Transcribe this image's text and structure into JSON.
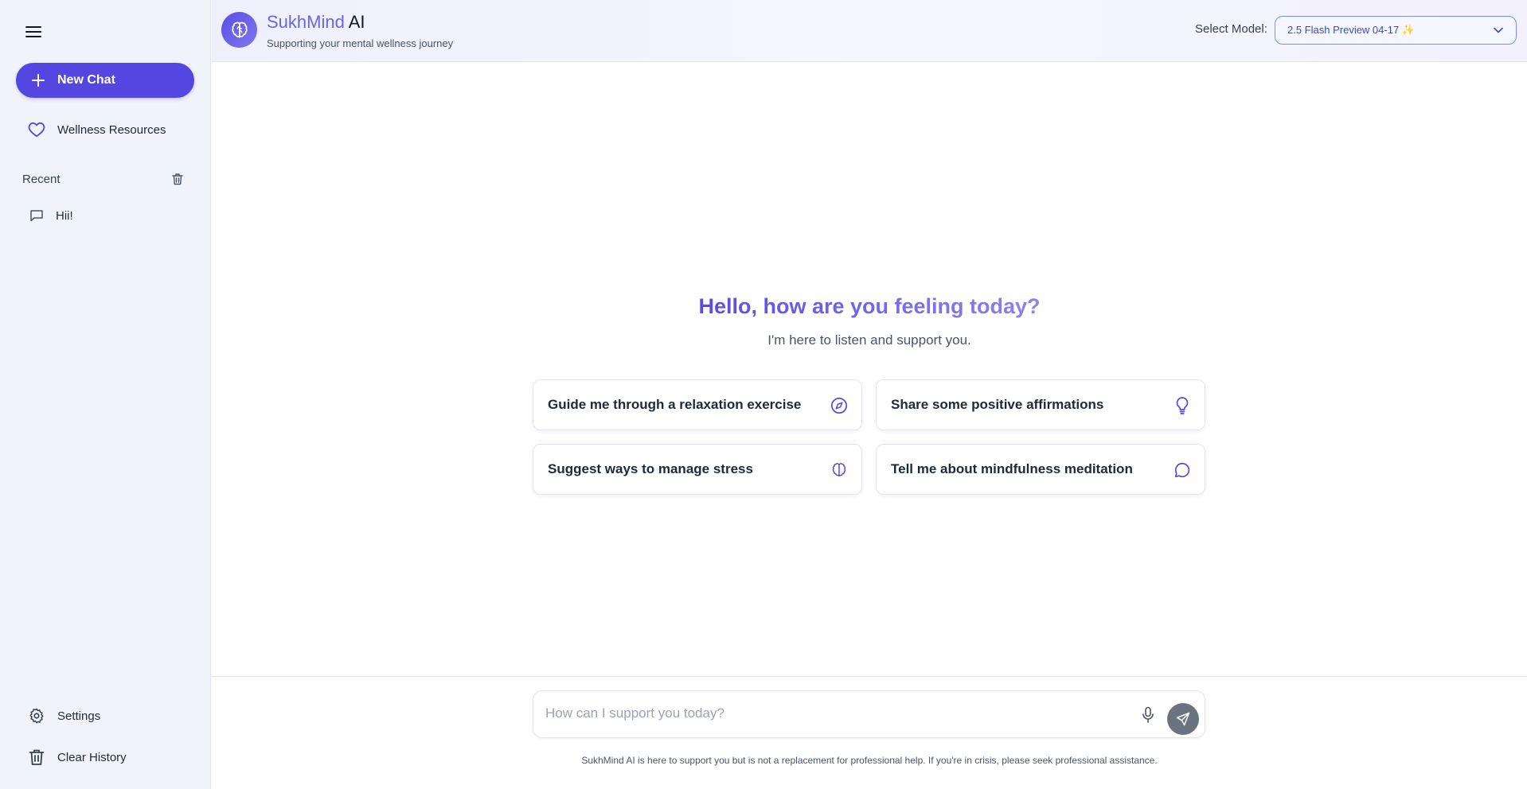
{
  "sidebar": {
    "new_chat_label": "New Chat",
    "wellness_label": "Wellness Resources",
    "recent_label": "Recent",
    "recent_chats": [
      "Hii!"
    ],
    "settings_label": "Settings",
    "clear_history_label": "Clear History"
  },
  "header": {
    "brand_part1": "SukhMind",
    "brand_part2": " AI",
    "tagline": "Supporting your mental wellness journey",
    "model_label": "Select Model:",
    "model_value": "2.5 Flash Preview 04-17 ✨"
  },
  "main": {
    "greeting": "Hello, how are you feeling today?",
    "subtitle": "I'm here to listen and support you.",
    "suggestions": [
      {
        "label": "Guide me through a relaxation exercise",
        "icon": "compass-icon"
      },
      {
        "label": "Share some positive affirmations",
        "icon": "lightbulb-icon"
      },
      {
        "label": "Suggest ways to manage stress",
        "icon": "brain-icon"
      },
      {
        "label": "Tell me about mindfulness meditation",
        "icon": "message-circle-icon"
      }
    ]
  },
  "composer": {
    "placeholder": "How can I support you today?",
    "disclaimer": "SukhMind AI is here to support you but is not a replacement for professional help. If you're in crisis, please seek professional assistance."
  },
  "colors": {
    "accent": "#5446e0",
    "sidebar_bg": "#f0f3f9",
    "send_button": "#6b7280"
  }
}
